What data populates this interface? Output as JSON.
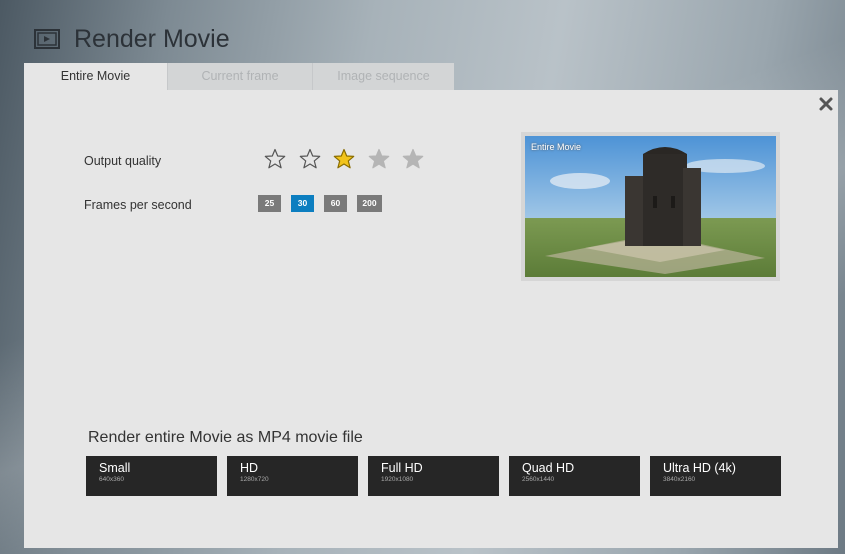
{
  "window": {
    "title": "Render Movie"
  },
  "tabs": [
    {
      "label": "Entire Movie",
      "active": true
    },
    {
      "label": "Current frame",
      "active": false
    },
    {
      "label": "Image sequence",
      "active": false
    }
  ],
  "settings": {
    "output_quality_label": "Output quality",
    "output_quality_value": 3,
    "output_quality_max": 5,
    "fps_label": "Frames per second",
    "fps_options": [
      "25",
      "30",
      "60",
      "200"
    ],
    "fps_selected": "30"
  },
  "preview": {
    "label": "Entire Movie"
  },
  "render": {
    "heading": "Render entire Movie as MP4 movie file",
    "options": [
      {
        "name": "Small",
        "resolution": "640x360"
      },
      {
        "name": "HD",
        "resolution": "1280x720"
      },
      {
        "name": "Full HD",
        "resolution": "1920x1080"
      },
      {
        "name": "Quad HD",
        "resolution": "2560x1440"
      },
      {
        "name": "Ultra HD (4k)",
        "resolution": "3840x2160"
      }
    ]
  },
  "colors": {
    "accent": "#0c7ec0",
    "star_active": "#f2c41c",
    "button_dark": "#262626",
    "panel": "#e6e6e6"
  },
  "icons": {
    "title": "film-frame-icon",
    "close": "close-icon"
  }
}
